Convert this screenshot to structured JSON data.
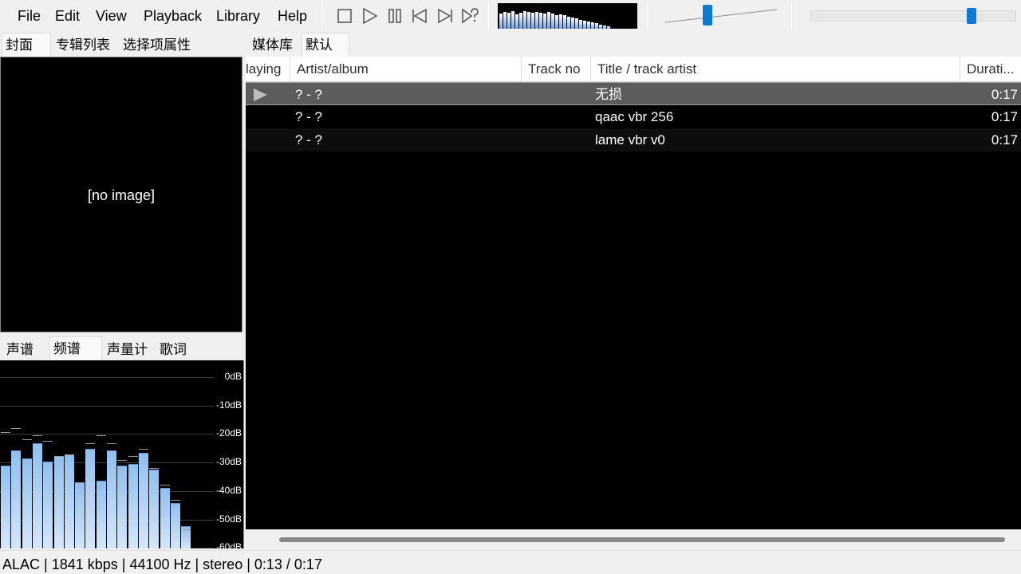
{
  "menu": {
    "file": "File",
    "edit": "Edit",
    "view": "View",
    "playback": "Playback",
    "library": "Library",
    "help": "Help"
  },
  "transport": {
    "stop_icon": "stop-icon",
    "play_icon": "play-icon",
    "pause_icon": "pause-icon",
    "previous_icon": "previous-icon",
    "next_icon": "next-icon",
    "random_icon": "random-icon"
  },
  "visualizer_levels": [
    0.62,
    0.7,
    0.66,
    0.72,
    0.6,
    0.68,
    0.74,
    0.71,
    0.65,
    0.7,
    0.67,
    0.63,
    0.69,
    0.64,
    0.58,
    0.6,
    0.55,
    0.5,
    0.46,
    0.42,
    0.38,
    0.34,
    0.3,
    0.26,
    0.22,
    0.18,
    0.14,
    0.1
  ],
  "volume_level": 0.37,
  "seek_position": 0.8,
  "left_tabs": {
    "cover": "封面",
    "album_list": "专辑列表",
    "selection_properties": "选择项属性"
  },
  "album_art": {
    "placeholder": "[no image]"
  },
  "vis_tabs": {
    "spectrogram": "声谱",
    "spectrum": "频谱",
    "vu_meter": "声量计",
    "lyrics": "歌词"
  },
  "spectrum": {
    "db_labels": [
      "0dB",
      "-10dB",
      "-20dB",
      "-30dB",
      "-40dB",
      "-50dB",
      "-60dB"
    ],
    "bars": [
      0.44,
      0.52,
      0.48,
      0.56,
      0.46,
      0.49,
      0.5,
      0.35,
      0.53,
      0.36,
      0.52,
      0.44,
      0.45,
      0.51,
      0.42,
      0.32,
      0.24,
      0.12
    ],
    "peaks": [
      0.62,
      0.64,
      0.58,
      0.6,
      0.57,
      0.49,
      0.5,
      0.35,
      0.56,
      0.6,
      0.56,
      0.47,
      0.49,
      0.53,
      0.43,
      0.34,
      0.26,
      0.1
    ]
  },
  "playlist_tabs": {
    "media_library": "媒体库",
    "default": "默认"
  },
  "columns": {
    "playing": "laying",
    "artist_album": "Artist/album",
    "track_no": "Track no",
    "title_artist": "Title / track artist",
    "duration": "Durati..."
  },
  "rows": [
    {
      "artist_album": "? - ?",
      "track_no": "",
      "title": "无损",
      "duration": "0:17",
      "playing": true
    },
    {
      "artist_album": "? - ?",
      "track_no": "",
      "title": "qaac vbr 256",
      "duration": "0:17",
      "playing": false
    },
    {
      "artist_album": "? - ?",
      "track_no": "",
      "title": "lame vbr v0",
      "duration": "0:17",
      "playing": false
    }
  ],
  "status": {
    "text": "ALAC | 1841 kbps | 44100 Hz | stereo | 0:13 / 0:17"
  },
  "colors": {
    "accent": "#0a7ad6",
    "panel_bg": "#000000",
    "playing_row": "#5c5c5c"
  }
}
